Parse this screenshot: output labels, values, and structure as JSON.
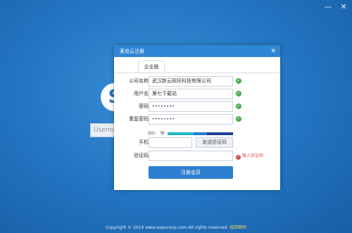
{
  "window": {
    "minimize_glyph": "—",
    "close_glyph": "✕"
  },
  "background": {
    "logo_glyph": "S",
    "username_placeholder": "Usernam"
  },
  "dialog": {
    "title": "莱克云注册",
    "close_glyph": "✕",
    "tabs": [
      {
        "label": "企业版",
        "active": true
      }
    ],
    "fields": [
      {
        "label": "公司名称",
        "value": "武汉新云网讯科技有限公司",
        "valid": true
      },
      {
        "label": "用户名",
        "value": "第七下载站",
        "valid": true
      },
      {
        "label": "密码",
        "value": "••••••••",
        "valid": true
      },
      {
        "label": "重复密码",
        "value": "••••••••",
        "valid": true
      }
    ],
    "password_strength": {
      "label": "密码：",
      "eye_glyph": "👁",
      "level": 1.0
    },
    "phone": {
      "label": "手机",
      "value": "",
      "send_button": "发送验证码"
    },
    "captcha": {
      "label": "验证码",
      "value": "",
      "warning": "输入验证码"
    },
    "submit_button": "注册会员",
    "ok_glyph": "✓",
    "warn_glyph": "!"
  },
  "footer": {
    "copyright": "Copyright © 2014 www.exponerp.com All rights reserved.",
    "link": "找回密码"
  },
  "colors": {
    "accent": "#2f7fd0",
    "ok": "#4cae4c",
    "warning": "#d9534f",
    "background": "#2273c0"
  }
}
